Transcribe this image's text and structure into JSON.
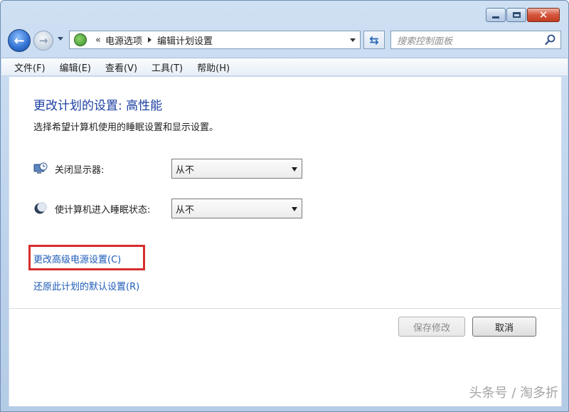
{
  "window": {
    "caption_buttons": [
      "minimize",
      "maximize",
      "close"
    ]
  },
  "address_bar": {
    "overflow_marker": "«",
    "crumbs": [
      "电源选项",
      "编辑计划设置"
    ]
  },
  "search": {
    "placeholder": "搜索控制面板"
  },
  "menu": {
    "items": [
      "文件(F)",
      "编辑(E)",
      "查看(V)",
      "工具(T)",
      "帮助(H)"
    ]
  },
  "main": {
    "title": "更改计划的设置: 高性能",
    "subtitle": "选择希望计算机使用的睡眠设置和显示设置。",
    "settings": [
      {
        "label": "关闭显示器:",
        "value": "从不",
        "icon": "monitor-clock-icon"
      },
      {
        "label": "使计算机进入睡眠状态:",
        "value": "从不",
        "icon": "moon-icon"
      }
    ],
    "links": {
      "advanced": "更改高级电源设置(C)",
      "restore": "还原此计划的默认设置(R)"
    }
  },
  "buttons": {
    "save": "保存修改",
    "cancel": "取消"
  },
  "watermark": "头条号 / 淘多折",
  "colors": {
    "title_blue": "#1c3fa3",
    "link_blue": "#1c5bb8",
    "highlight_red": "#d62e2e"
  }
}
